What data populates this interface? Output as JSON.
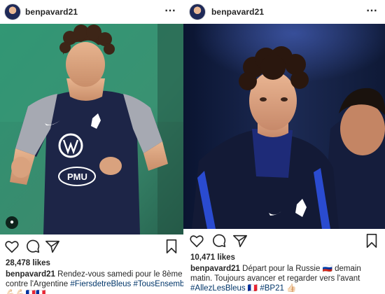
{
  "posts": [
    {
      "username": "benpavard21",
      "more_icon": "⋯",
      "likes": "28,478 likes",
      "caption": {
        "username": "benpavard21",
        "line1_text": " Rendez-vous samedi pour le 8ème",
        "line2_text": "contre l'Argentine ",
        "line2_tag1": "#FiersdetreBleus",
        "line2_tag2": "#TousEnsemble",
        "line3_emojis": "💪🏻💪🏻🇫🇷🇫🇷"
      },
      "photo": {
        "description_icons": [
          "person-tag-icon"
        ],
        "shirt_sponsor": "PMU",
        "colors": {
          "background": "#2f8a6b",
          "shirt": "#1d2547",
          "sleeve": "#9a9ea8"
        }
      }
    },
    {
      "username": "benpavard21",
      "more_icon": "⋯",
      "likes": "10,471 likes",
      "caption": {
        "username": "benpavard21",
        "line1_text": " Départ pour la Russie 🇷🇺 demain",
        "line2_text": "matin. Toujours avancer et regarder vers l'avant",
        "line3_tag1": "#AllezLesBleus",
        "line3_mid": " 🇫🇷 ",
        "line3_tag2": "#BP21",
        "line3_end": " 👍🏻"
      },
      "photo": {
        "colors": {
          "background": "#0f1a33",
          "jacket": "#141c38",
          "accent": "#2a4bd0"
        }
      }
    }
  ],
  "icons": [
    "heart-icon",
    "comment-icon",
    "share-icon",
    "bookmark-icon"
  ]
}
